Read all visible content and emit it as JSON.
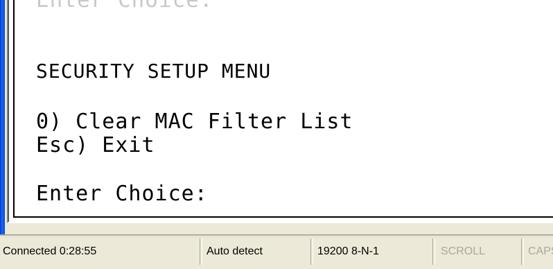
{
  "terminal": {
    "cut_off_line": "Enter Choice:",
    "menu_title": "SECURITY SETUP MENU",
    "option_0": "0) Clear MAC Filter List",
    "option_esc": "Esc) Exit",
    "prompt": "Enter Choice:"
  },
  "status_bar": {
    "connection": "Connected 0:28:55",
    "detect": "Auto detect",
    "settings": "19200 8-N-1",
    "scroll": "SCROLL",
    "caps": "CAPS"
  },
  "colors": {
    "terminal_bg": "#ffffff",
    "terminal_text": "#000000",
    "chrome": "#ece9d8",
    "xp_blue": "#0a47d6",
    "disabled_text": "#aca899"
  }
}
